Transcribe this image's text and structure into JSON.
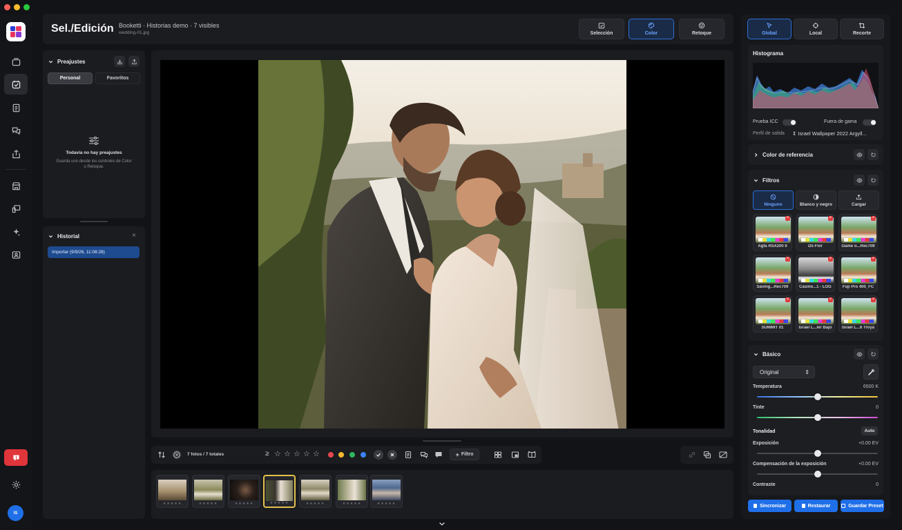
{
  "window": {
    "traffic": [
      "#ff5f57",
      "#febc2e",
      "#28c840"
    ]
  },
  "header": {
    "title": "Sel./Edición",
    "subtitle": "Booketti · Historias demo · 7 visibles",
    "filename": "wedding-01.jpg",
    "modes": [
      {
        "label": "Selección",
        "icon": "selection-icon",
        "active": false
      },
      {
        "label": "Color",
        "icon": "palette-icon",
        "active": true
      },
      {
        "label": "Retoque",
        "icon": "retouch-icon",
        "active": false
      }
    ]
  },
  "left": {
    "presets_title": "Preajustes",
    "tabs": [
      "Personal",
      "Favoritos"
    ],
    "empty_title": "Todavía no hay preajustes",
    "empty_text_1": "Guarda uno desde los controles de Color",
    "empty_text_2": "o Retoque.",
    "history_title": "Historial",
    "history_item": "Importar (9/9/26, 11:08:28)"
  },
  "right": {
    "tabs": [
      {
        "label": "Global",
        "icon": "cursor-icon",
        "active": true
      },
      {
        "label": "Local",
        "icon": "target-icon",
        "active": false
      },
      {
        "label": "Recorte",
        "icon": "crop-icon",
        "active": false
      }
    ],
    "histogram_title": "Histograma",
    "icc_label": "Prueba ICC",
    "gamut_label": "Fuera de gama",
    "output_label": "Perfil de salida",
    "output_value": "Israel Wallpaper 2022 Argyll...",
    "reference_title": "Color de referencia",
    "filters_title": "Filtros",
    "filter_modes": [
      {
        "label": "Ninguno",
        "active": true
      },
      {
        "label": "Blanco y negro",
        "active": false
      },
      {
        "label": "Cargar",
        "active": false
      }
    ],
    "luts": [
      {
        "name": "Agfa RSX200 II",
        "bw": false
      },
      {
        "name": "D5 Flor",
        "bw": false
      },
      {
        "name": "Game o...Rec709",
        "bw": false
      },
      {
        "name": "Saving...Rec709",
        "bw": false
      },
      {
        "name": "Casino...1 - LOG",
        "bw": true
      },
      {
        "name": "Fuji Pro 400_FC",
        "bw": false
      },
      {
        "name": "SUMMIT 01",
        "bw": false
      },
      {
        "name": "Israel L...ler Bajo",
        "bw": false
      },
      {
        "name": "Israel L...6 Troya",
        "bw": false
      }
    ],
    "basic_title": "Básico",
    "profile_value": "Original",
    "temperature_label": "Temperatura",
    "temperature_value": "6500 K",
    "temperature_level": 0.5,
    "tint_label": "Tinte",
    "tint_value": "0",
    "tint_level": 0.5,
    "tonality_label": "Tonalidad",
    "auto_label": "Auto",
    "exposure_label": "Exposición",
    "exposure_value": "+0.00 EV",
    "exposure_level": 0.5,
    "exp_comp_label": "Compensación de la exposición",
    "exp_comp_value": "+0.00 EV",
    "exp_comp_level": 0.5,
    "contrast_label": "Contraste",
    "contrast_value": "0",
    "buttons": [
      "Sincronizar",
      "Restaurar",
      "Guardar Preset"
    ]
  },
  "toolbar": {
    "count": "7 fotos / 7 totales",
    "rating_op": "≥",
    "filter_label": "Filtro",
    "color_labels": [
      "#e5484d",
      "#f5b92e",
      "#2fb65d",
      "#3b82f6"
    ]
  },
  "filmstrip": {
    "count": 7,
    "selected_index": 3
  },
  "user": {
    "initials": "IS"
  }
}
